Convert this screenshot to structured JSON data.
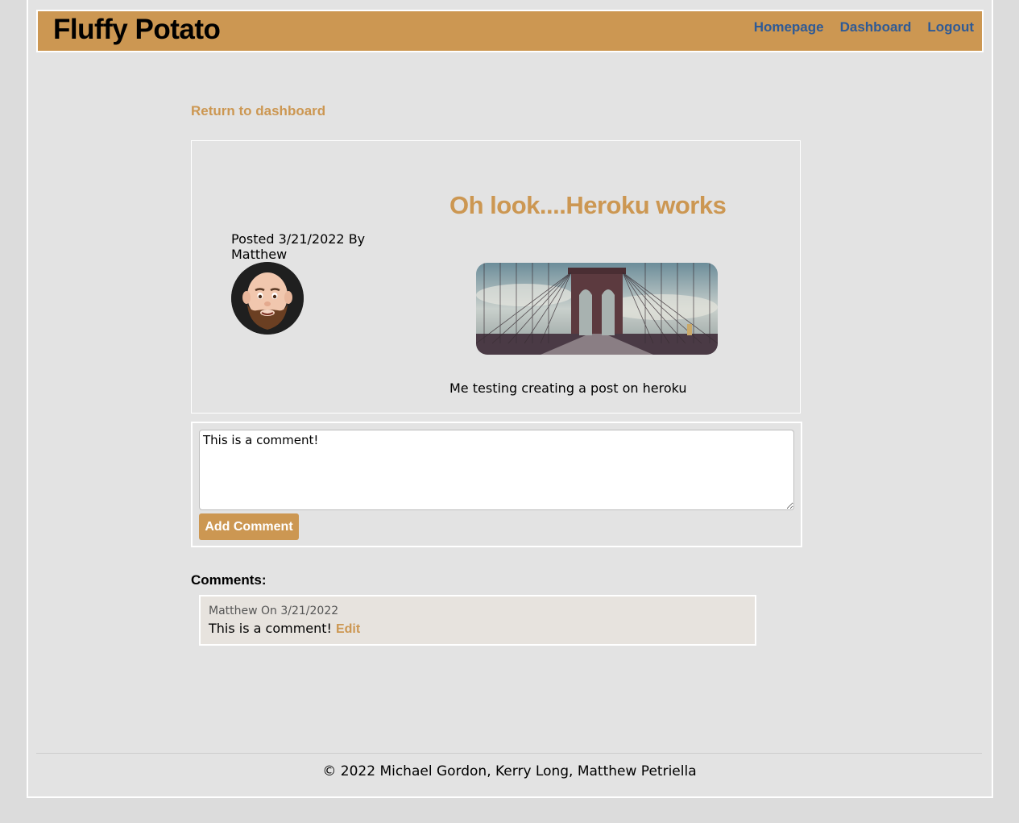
{
  "header": {
    "brand": "Fluffy Potato",
    "nav": [
      {
        "label": "Homepage"
      },
      {
        "label": "Dashboard"
      },
      {
        "label": "Logout"
      }
    ]
  },
  "return_link": "Return to dashboard",
  "post": {
    "meta": "Posted 3/21/2022 By Matthew",
    "title": "Oh look....Heroku works",
    "body": "Me testing creating a post on heroku"
  },
  "comment_form": {
    "value": "This is a comment!",
    "button_label": "Add Comment"
  },
  "comments": {
    "heading": "Comments:",
    "items": [
      {
        "meta": "Matthew On 3/21/2022",
        "text": "This is a comment!",
        "edit_label": "Edit"
      }
    ]
  },
  "footer": {
    "text": "© 2022 Michael Gordon, Kerry Long, Matthew Petriella"
  },
  "colors": {
    "accent": "#cc9752",
    "nav_link": "#2e5a96",
    "background": "#e3e3e3"
  },
  "icons": {
    "avatar": "user-avatar-memoji",
    "post_image": "brooklyn-bridge-photo"
  }
}
